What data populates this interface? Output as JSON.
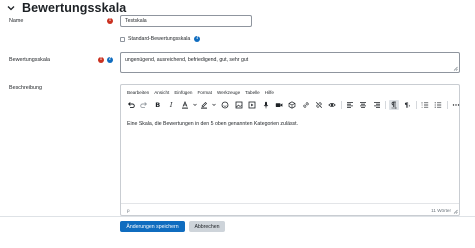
{
  "section": {
    "title": "Bewertungsskala",
    "icon": "chevron-down-icon"
  },
  "fields": {
    "name": {
      "label": "Name",
      "value": "Testskala"
    },
    "standard": {
      "label": "Standard-Bewertungsskala"
    },
    "scale": {
      "label": "Bewertungsskala",
      "value": "ungenügend, ausreichend, befriedigend, gut, sehr gut"
    },
    "description": {
      "label": "Beschreibung"
    }
  },
  "editor": {
    "menu": [
      "Bearbeiten",
      "Ansicht",
      "Einfügen",
      "Format",
      "Werkzeuge",
      "Tabelle",
      "Hilfe"
    ],
    "toolbar_icons": [
      "undo-icon",
      "redo-icon",
      "bold-icon",
      "italic-icon",
      "text-color-icon",
      "highlight-icon",
      "emoji-icon",
      "image-icon",
      "media-icon",
      "record-audio-icon",
      "record-video-icon",
      "h5p-icon",
      "link-icon",
      "unlink-icon",
      "accessibility-checker-icon",
      "align-left-icon",
      "align-center-icon",
      "align-right-icon",
      "ltr-icon",
      "rtl-icon",
      "numbered-list-icon",
      "bullet-list-icon",
      "more-icon"
    ],
    "content": "Eine Skala, die Bewertungen in den 5 oben genannten Kategorien zulässt.",
    "status_path": "p",
    "word_count": "11 Wörter"
  },
  "buttons": {
    "save": "Änderungen speichern",
    "cancel": "Abbrechen"
  },
  "colors": {
    "required": "#ca3120",
    "help": "#0f6cbf",
    "primary": "#0f6cbf"
  }
}
